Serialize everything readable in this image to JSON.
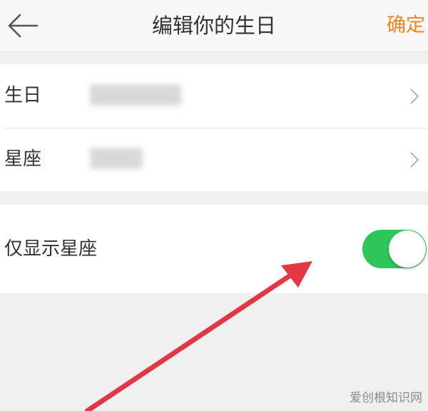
{
  "nav": {
    "back_icon": "back-arrow-icon",
    "title": "编辑你的生日",
    "confirm_label": "确定",
    "confirm_color": "#f5821f"
  },
  "rows": [
    {
      "label": "生日",
      "value_blurred": true,
      "chevron_icon": "chevron-right-icon"
    },
    {
      "label": "星座",
      "value_blurred": true,
      "chevron_icon": "chevron-right-icon"
    }
  ],
  "toggle_row": {
    "label": "仅显示星座",
    "toggle_on": true,
    "toggle_color": "#2ec55a"
  },
  "annotation": {
    "arrow_icon": "red-arrow-icon",
    "arrow_color": "#e23744"
  },
  "watermark": "爱创根知识网"
}
